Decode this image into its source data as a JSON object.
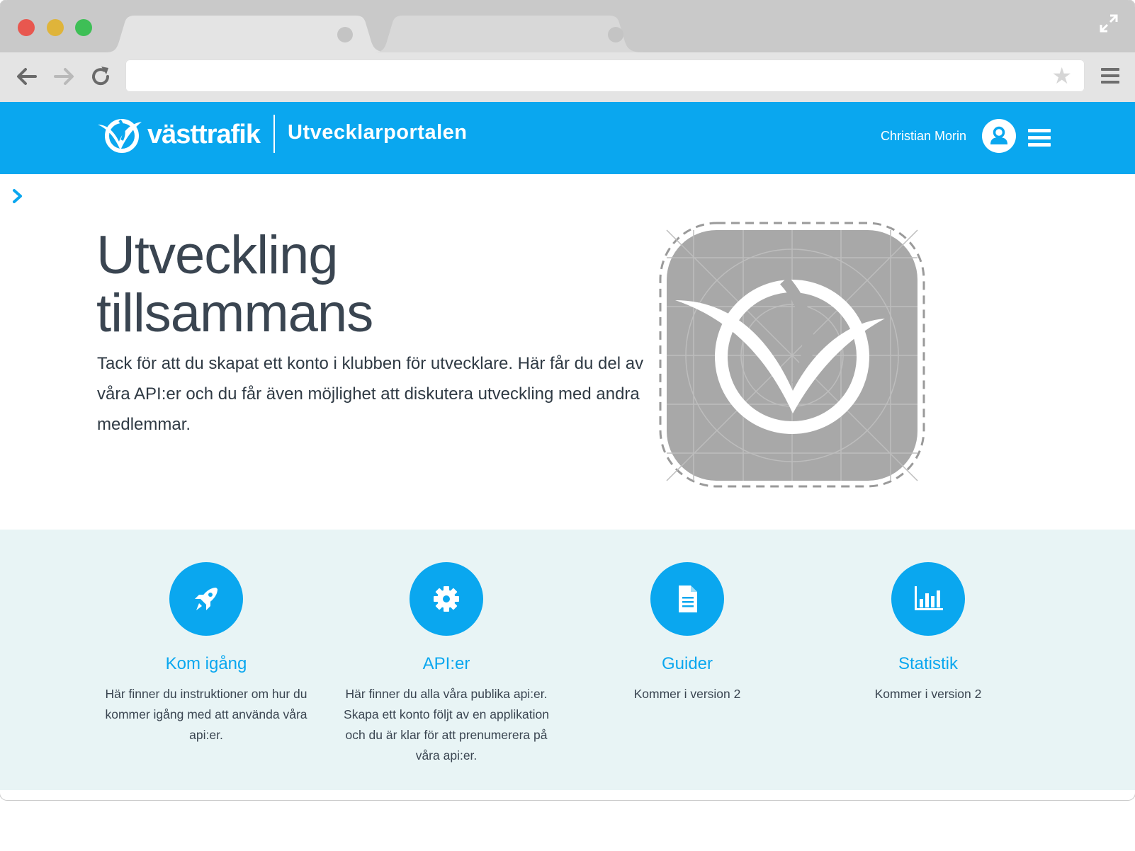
{
  "browser": {
    "url": "",
    "icons": {
      "back": "arrow-left-icon",
      "forward": "arrow-right-icon",
      "reload": "reload-icon",
      "bookmark": "star-icon",
      "menu": "hamburger-icon",
      "fullscreen": "expand-icon"
    }
  },
  "header": {
    "logo_text": "västtrafik",
    "portal_title": "Utvecklarportalen",
    "user_name": "Christian Morin",
    "brand_color": "#0aa7ef"
  },
  "hero": {
    "title_line1": "Utveckling",
    "title_line2": "tillsammans",
    "text": "Tack för att du skapat ett konto i klubben för utvecklare. Här får du del av våra API:er och du får även möjlighet att diskutera utveckling med andra medlemmar."
  },
  "features": [
    {
      "title": "Kom igång",
      "description": "Här finner du instruktioner om hur du kommer igång med att använda våra api:er.",
      "icon": "rocket-icon"
    },
    {
      "title": "API:er",
      "description": "Här finner du alla våra publika api:er. Skapa ett konto följt av en applikation och du är klar för att prenumerera på våra api:er.",
      "icon": "gear-icon"
    },
    {
      "title": "Guider",
      "description": "Kommer i version 2",
      "icon": "document-icon"
    },
    {
      "title": "Statistik",
      "description": "Kommer i version 2",
      "icon": "bar-chart-icon"
    }
  ]
}
